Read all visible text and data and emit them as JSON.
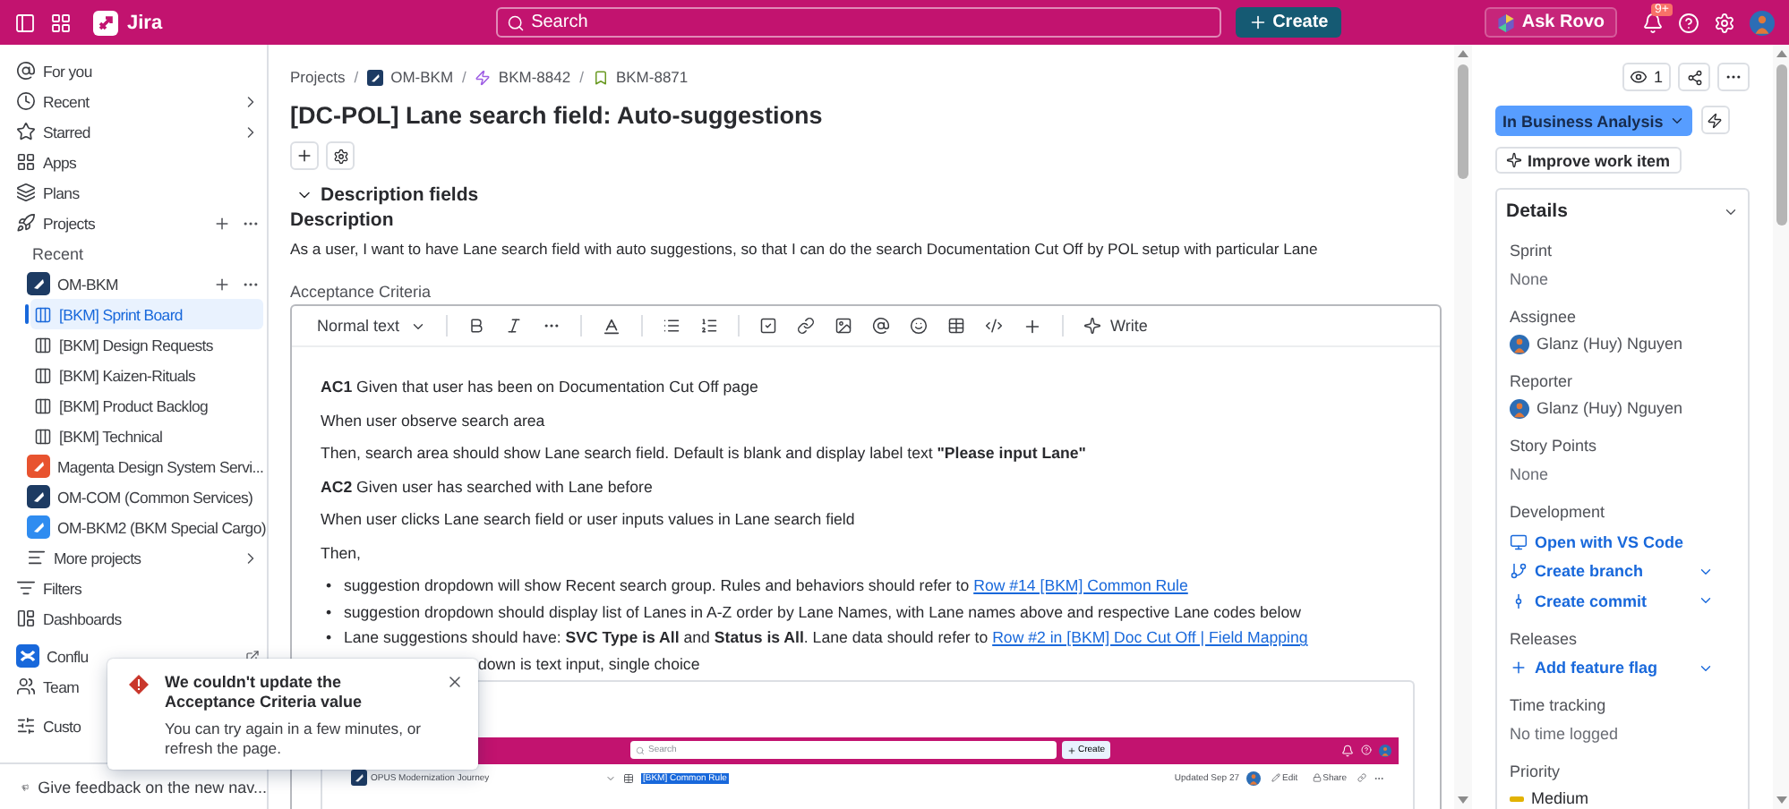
{
  "top_bar": {
    "app_name": "Jira",
    "search": {
      "placeholder": "Search"
    },
    "create_button": "Create",
    "ask_button": "Ask Rovo",
    "notification_badge": "9+"
  },
  "sidebar": {
    "items": [
      {
        "kind": "nav",
        "label": "For you",
        "selected": false
      },
      {
        "kind": "menu",
        "label": "Recent",
        "selected": false
      },
      {
        "kind": "menu",
        "label": "Starred",
        "selected": false
      },
      {
        "kind": "nav",
        "label": "Apps",
        "selected": false
      },
      {
        "kind": "nav",
        "label": "Plans",
        "selected": false
      },
      {
        "kind": "section",
        "label": "Projects",
        "selected": false
      },
      {
        "kind": "heading",
        "label": "Recent"
      },
      {
        "kind": "project",
        "label": "OM-BKM",
        "color": "#1d3b63",
        "selected": false,
        "children": [
          {
            "label": "[BKM] Sprint Board",
            "selected": true
          },
          {
            "label": "[BKM] Design Requests",
            "selected": false
          },
          {
            "label": "[BKM] Kaizen-Rituals",
            "selected": false
          },
          {
            "label": "[BKM] Product Backlog",
            "selected": false
          },
          {
            "label": "[BKM] Technical",
            "selected": false
          }
        ]
      },
      {
        "kind": "project",
        "label": "Magenta Design System Servi...",
        "color": "#e8532f",
        "selected": false
      },
      {
        "kind": "project",
        "label": "OM-COM (Common Services)",
        "color": "#1d3b63",
        "selected": false
      },
      {
        "kind": "project",
        "label": "OM-BKM2 (BKM Special Cargo)",
        "color": "#2f8cf0",
        "selected": false
      },
      {
        "kind": "more",
        "label": "More projects",
        "selected": false
      },
      {
        "kind": "nav",
        "label": "Filters",
        "selected": false
      },
      {
        "kind": "nav",
        "label": "Dashboards",
        "selected": false
      },
      {
        "kind": "app",
        "label": "Conflu",
        "selected": false
      },
      {
        "kind": "nav",
        "label": "Team",
        "selected": false
      },
      {
        "kind": "nav",
        "label": "Custo",
        "selected": false
      }
    ],
    "feedback": "Give feedback on the new nav..."
  },
  "breadcrumbs": [
    "Projects",
    "OM-BKM",
    "BKM-8842",
    "BKM-8871"
  ],
  "breadcrumb_separator": "/",
  "title": "[DC-POL] Lane search field: Auto-suggestions",
  "fields_section": {
    "label": "Description fields",
    "expanded": true
  },
  "description": {
    "heading": "Description",
    "text": "As a user, I want to have Lane search field with auto suggestions, so that I can do the search Documentation Cut Off by POL setup with particular Lane"
  },
  "acceptance": {
    "label": "Acceptance Criteria",
    "toolbar": {
      "text_style": "Normal text",
      "write": "Write"
    },
    "paragraphs": [
      "**AC1** Given that user has been on Documentation Cut Off page",
      "When user observe search area",
      "Then, search area should show Lane search field. Default is blank and display label text **\"Please input Lane\"**",
      "**AC2** Given user has searched with Lane before",
      "When user clicks Lane search field or user inputs values in Lane search field",
      "Then,"
    ],
    "bullets": [
      {
        "kind": "full",
        "marker": "•",
        "text": "suggestion dropdown will show Recent search group. Rules and behaviors should refer to ",
        "link": "Row #14 [BKM] Common Rule"
      },
      {
        "kind": "full",
        "marker": "•",
        "text": "suggestion dropdown should display list of Lanes in A-Z order by Lane Names, with Lane names above and respective Lane codes below"
      },
      {
        "kind": "full",
        "marker": "•",
        "text": "Lane suggestions should have: **SVC Type is All** and **Status is All**. Lane data should refer to ",
        "link": "Row #2 in [BKM] Doc Cut Off | Field Mapping"
      },
      {
        "kind": "covered",
        "text": "down is text input, single choice"
      }
    ],
    "embedded_screenshot": {
      "search": "Search",
      "create": "Create",
      "sidebar_item": "OPUS Modernization Journey",
      "page_title": "[BKM] Common Rule",
      "updated": "Updated Sep 27",
      "edit": "Edit",
      "share": "Share"
    }
  },
  "side_panel": {
    "watchers": "1",
    "status": "In Business Analysis",
    "improve": "Improve work item",
    "details": {
      "title": "Details",
      "expanded": true,
      "fields": [
        {
          "kind": "text",
          "label": "Sprint",
          "value": "None"
        },
        {
          "kind": "person",
          "label": "Assignee",
          "value": "Glanz (Huy) Nguyen"
        },
        {
          "kind": "person",
          "label": "Reporter",
          "value": "Glanz (Huy) Nguyen"
        },
        {
          "kind": "text",
          "label": "Story Points",
          "value": "None"
        },
        {
          "kind": "links",
          "label": "Development",
          "links": [
            {
              "label": "Open with VS Code",
              "has_menu": false
            },
            {
              "label": "Create branch",
              "has_menu": true
            },
            {
              "label": "Create commit",
              "has_menu": true
            }
          ]
        },
        {
          "kind": "links",
          "label": "Releases",
          "links": [
            {
              "label": "Add feature flag",
              "has_menu": true
            }
          ]
        },
        {
          "kind": "text",
          "label": "Time tracking",
          "value": "No time logged"
        },
        {
          "kind": "priority",
          "label": "Priority",
          "value": "Medium"
        }
      ]
    }
  },
  "toast": {
    "title": "We couldn't update the Acceptance Criteria value",
    "message": "You can try again in a few minutes, or refresh the page."
  }
}
